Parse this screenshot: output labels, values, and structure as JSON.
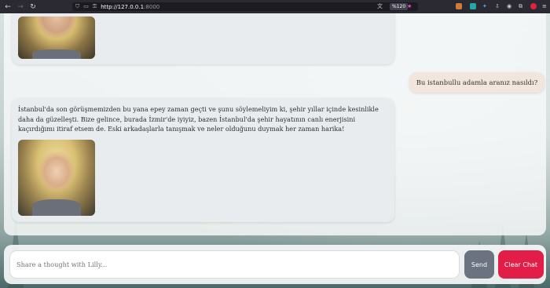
{
  "browser": {
    "url_host": "http://127.0.0.1",
    "url_port": ":8000",
    "zoom": "%120",
    "icons": [
      "back-arrow-icon",
      "forward-arrow-icon",
      "reload-icon",
      "shield-icon",
      "page-icon",
      "lock-icon",
      "translate-icon",
      "bookmark-star-icon",
      "extensions-icon",
      "menu-icon"
    ]
  },
  "chat": {
    "messages": [
      {
        "role": "bot",
        "text": "",
        "has_image": true
      },
      {
        "role": "user",
        "text": "Bu istanbullu adamla aranız nasıldı?"
      },
      {
        "role": "bot",
        "text": "İstanbul'da son görüşmemizden bu yana epey zaman geçti ve şunu söylemeliyim ki, şehir yıllar içinde kesinlikle daha da güzelleşti. Bize gelince, burada İzmir'de iyiyiz, bazen İstanbul'da şehir hayatının canlı enerjisini kaçırdığımı itiraf etsem de. Eski arkadaşlarla tanışmak ve neler olduğunu duymak her zaman harika!",
        "has_image": true
      }
    ]
  },
  "composer": {
    "placeholder": "Share a thought with Lilly...",
    "value": "",
    "send_label": "Send",
    "clear_label": "Clear Chat"
  },
  "colors": {
    "send": "#6b7280",
    "clear": "#e11d48",
    "user_bubble": "#f2e6dc",
    "bot_bubble": "#e9ecee"
  }
}
